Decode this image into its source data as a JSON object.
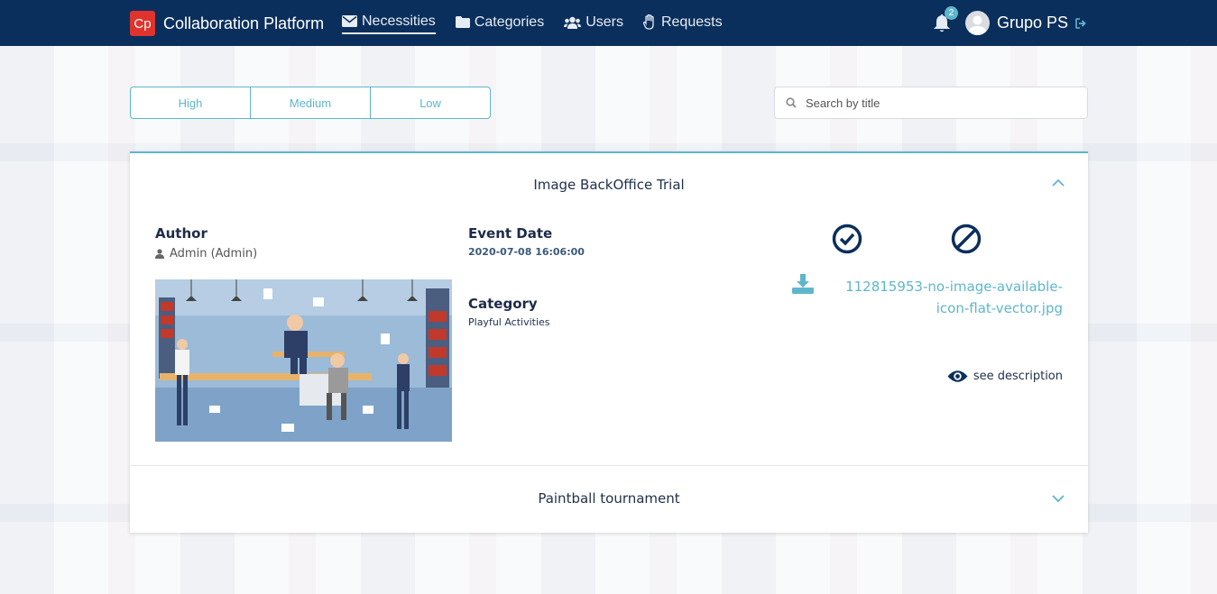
{
  "navbar": {
    "logo_text": "Cp",
    "app_name": "Collaboration Platform",
    "links": [
      {
        "label": "Necessities",
        "icon": "envelope-icon",
        "active": true
      },
      {
        "label": "Categories",
        "icon": "folder-icon",
        "active": false
      },
      {
        "label": "Users",
        "icon": "users-icon",
        "active": false
      },
      {
        "label": "Requests",
        "icon": "hand-icon",
        "active": false
      }
    ],
    "notification_count": "2",
    "user_name": "Grupo PS"
  },
  "filters": {
    "priorities": [
      "High",
      "Medium",
      "Low"
    ],
    "search_placeholder": "Search by title"
  },
  "items": [
    {
      "title": "Image BackOffice Trial",
      "expanded": true,
      "author_label": "Author",
      "author_value": "Admin (Admin)",
      "event_date_label": "Event Date",
      "event_date_value": "2020-07-08 16:06:00",
      "category_label": "Category",
      "category_value": "Playful Activities",
      "attachment": "112815953-no-image-available-icon-flat-vector.jpg",
      "see_description": "see description"
    },
    {
      "title": "Paintball tournament",
      "expanded": false
    }
  ],
  "colors": {
    "navbar": "#0b2f5c",
    "accent": "#5eb6cc",
    "brand": "#e0332d"
  }
}
